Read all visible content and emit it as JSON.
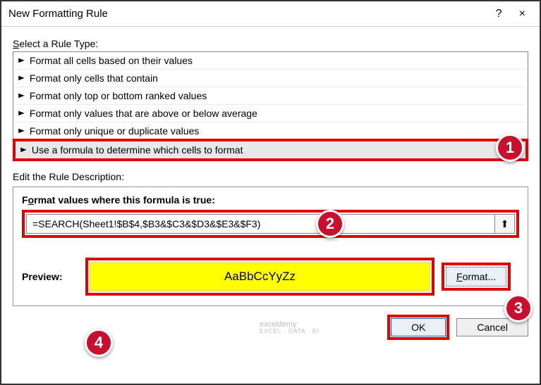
{
  "titlebar": {
    "title": "New Formatting Rule",
    "help": "?",
    "close": "×"
  },
  "ruleType": {
    "label_pre": "S",
    "label_post": "elect a Rule Type:",
    "items": [
      "Format all cells based on their values",
      "Format only cells that contain",
      "Format only top or bottom ranked values",
      "Format only values that are above or below average",
      "Format only unique or duplicate values",
      "Use a formula to determine which cells to format"
    ]
  },
  "description": {
    "label": "Edit the Rule Description:",
    "formula_label_pre": "F",
    "formula_label_u": "o",
    "formula_label_post": "rmat values where this formula is true:",
    "formula_value": "=SEARCH(Sheet1!$B$4,$B3&$C3&$D3&$E3&$F3)"
  },
  "preview": {
    "label": "Preview:",
    "sample": "AaBbCcYyZz",
    "format_btn_pre": "",
    "format_btn_u": "F",
    "format_btn_post": "ormat..."
  },
  "buttons": {
    "ok": "OK",
    "cancel": "Cancel"
  },
  "watermark": {
    "line1": "exceldemy",
    "line2": "EXCEL · DATA · BI"
  },
  "badges": {
    "b1": "1",
    "b2": "2",
    "b3": "3",
    "b4": "4"
  },
  "icons": {
    "collapse": "⬆"
  }
}
